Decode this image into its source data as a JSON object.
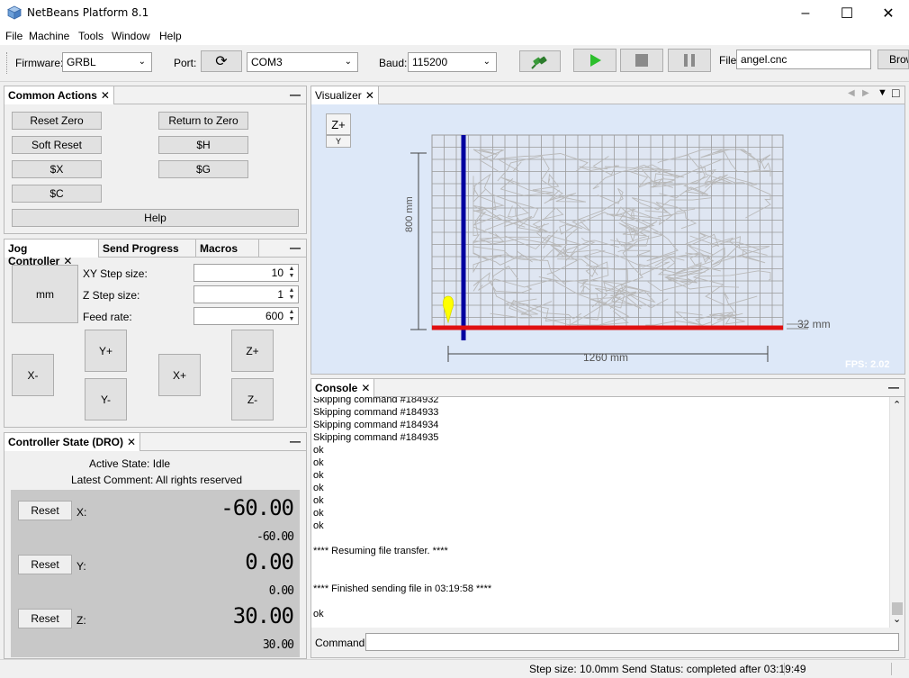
{
  "window": {
    "title": "NetBeans Platform 8.1"
  },
  "menu": [
    "File",
    "Machine",
    "Tools",
    "Window",
    "Help"
  ],
  "toolbar": {
    "firmware_label": "Firmware:",
    "firmware_value": "GRBL",
    "port_label": "Port:",
    "port_value": "COM3",
    "baud_label": "Baud:",
    "baud_value": "115200",
    "file_label": "File",
    "file_value": "angel.cnc",
    "browse_label": "Brow"
  },
  "common_actions": {
    "tab": "Common Actions",
    "buttons": {
      "reset_zero": "Reset Zero",
      "return_to_zero": "Return to Zero",
      "soft_reset": "Soft Reset",
      "dollar_h": "$H",
      "dollar_x": "$X",
      "dollar_g": "$G",
      "dollar_c": "$C",
      "help": "Help"
    }
  },
  "jog": {
    "tabs": [
      "Jog Controller",
      "Send Progress",
      "Macros"
    ],
    "unit_button": "mm",
    "xy_step_label": "XY Step size:",
    "xy_step_value": "10",
    "z_step_label": "Z Step size:",
    "z_step_value": "1",
    "feed_label": "Feed rate:",
    "feed_value": "600",
    "buttons": {
      "y_plus": "Y+",
      "y_minus": "Y-",
      "x_minus": "X-",
      "x_plus": "X+",
      "z_plus": "Z+",
      "z_minus": "Z-"
    }
  },
  "dro": {
    "tab": "Controller State (DRO)",
    "active_state_label": "Active State:",
    "active_state_value": "Idle",
    "latest_comment_label": "Latest Comment:",
    "latest_comment_value": "All rights reserved",
    "reset_label": "Reset",
    "axes": [
      {
        "name": "X:",
        "work": "-60.00",
        "machine": "-60.00"
      },
      {
        "name": "Y:",
        "work": "0.00",
        "machine": "0.00"
      },
      {
        "name": "Z:",
        "work": "30.00",
        "machine": "30.00"
      }
    ]
  },
  "visualizer": {
    "tab": "Visualizer",
    "z_plus": "Z+",
    "z_minus": "Y",
    "height_label": "800 mm",
    "width_label": "1260 mm",
    "depth_label": "32 mm",
    "fps": "FPS: 2.02"
  },
  "console": {
    "tab": "Console",
    "lines": [
      "Skipping command #184932",
      "Skipping command #184933",
      "Skipping command #184934",
      "Skipping command #184935",
      "ok",
      "ok",
      "ok",
      "ok",
      "ok",
      "ok",
      "ok",
      "",
      "**** Resuming file transfer. ****",
      "",
      "",
      "**** Finished sending file in 03:19:58 ****",
      "",
      "ok"
    ],
    "command_label": "Command:"
  },
  "statusbar": {
    "text": "Step size: 10.0mm Send Status: completed after 03:19:49"
  },
  "colors": {
    "x_axis": "#e01010",
    "y_axis": "#0000a0",
    "toolpath": "#b9b9b9",
    "grid": "#9a9a9a",
    "viz_bg": "#dde8f8",
    "play": "#2cbf2c",
    "marker": "#ffff00"
  }
}
